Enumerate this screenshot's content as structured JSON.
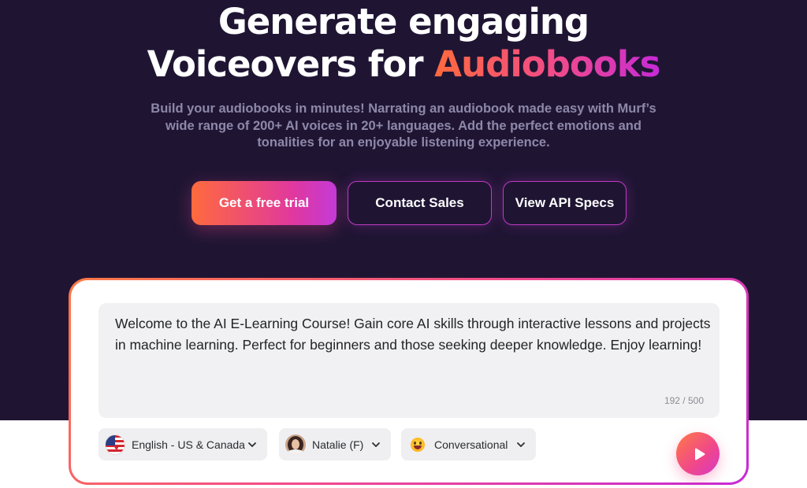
{
  "hero": {
    "headline_line1": "Generate engaging",
    "headline_line2_prefix": "Voiceovers for ",
    "headline_line2_accent": "Audiobooks",
    "subtitle": "Build your audiobooks in minutes! Narrating an audiobook made easy with Murf’s wide range of 200+ AI voices in 20+ languages. Add the perfect emotions and tonalities for an enjoyable listening experience.",
    "cta_trial": "Get a free trial",
    "cta_contact": "Contact Sales",
    "cta_api": "View API Specs"
  },
  "demo": {
    "script_text": "Welcome to the AI E-Learning Course! Gain core AI skills through interactive lessons and projects in machine learning. Perfect for beginners and those seeking deeper knowledge. Enjoy learning!",
    "char_count": "192 / 500",
    "language": "English - US & Canada",
    "voice": "Natalie (F)",
    "style": "Conversational"
  },
  "colors": {
    "hero_bg": "#1f1533",
    "accent_orange": "#ff6a3d",
    "accent_pink": "#f04a8c",
    "accent_purple": "#c62ad6"
  },
  "icons": {
    "language": "us-flag-icon",
    "voice": "avatar-natalie",
    "style": "smiling-emoji-icon",
    "dropdown": "chevron-down-icon",
    "play": "play-icon"
  }
}
